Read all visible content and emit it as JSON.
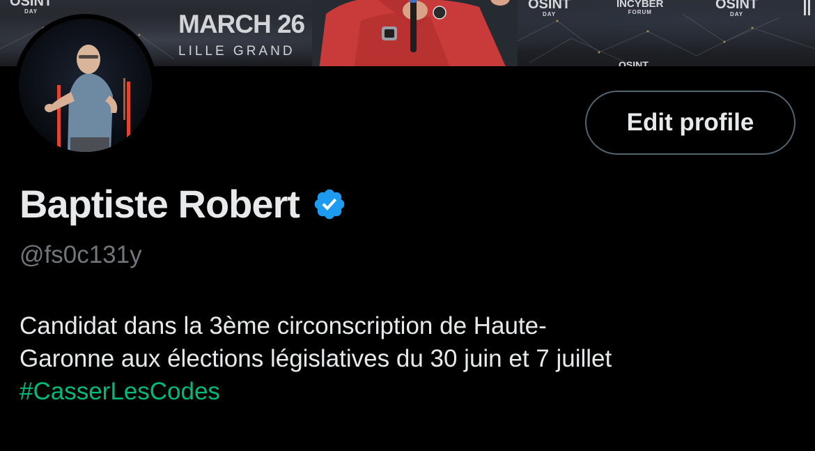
{
  "banner": {
    "logos": [
      {
        "name": "OSINT",
        "sub": "DAY"
      },
      {
        "name": "OSINT",
        "sub": "DAY"
      },
      {
        "name": "INCYBER",
        "sub": "FORUM"
      },
      {
        "name": "OSINT",
        "sub": "DAY"
      },
      {
        "name": "OSINT",
        "sub": ""
      }
    ],
    "date": "MARCH 26",
    "place": "LILLE GRAND"
  },
  "profile": {
    "display_name": "Baptiste Robert",
    "verified": true,
    "verified_color": "#1d9bf0",
    "handle": "@fs0c131y",
    "edit_button_label": "Edit profile",
    "bio_lines": [
      "Candidat dans la 3ème circonscription de Haute-",
      "Garonne aux élections législatives du 30 juin et 7 juillet"
    ],
    "hashtag": "#CasserLesCodes",
    "hashtag_color": "#00ba7c"
  }
}
